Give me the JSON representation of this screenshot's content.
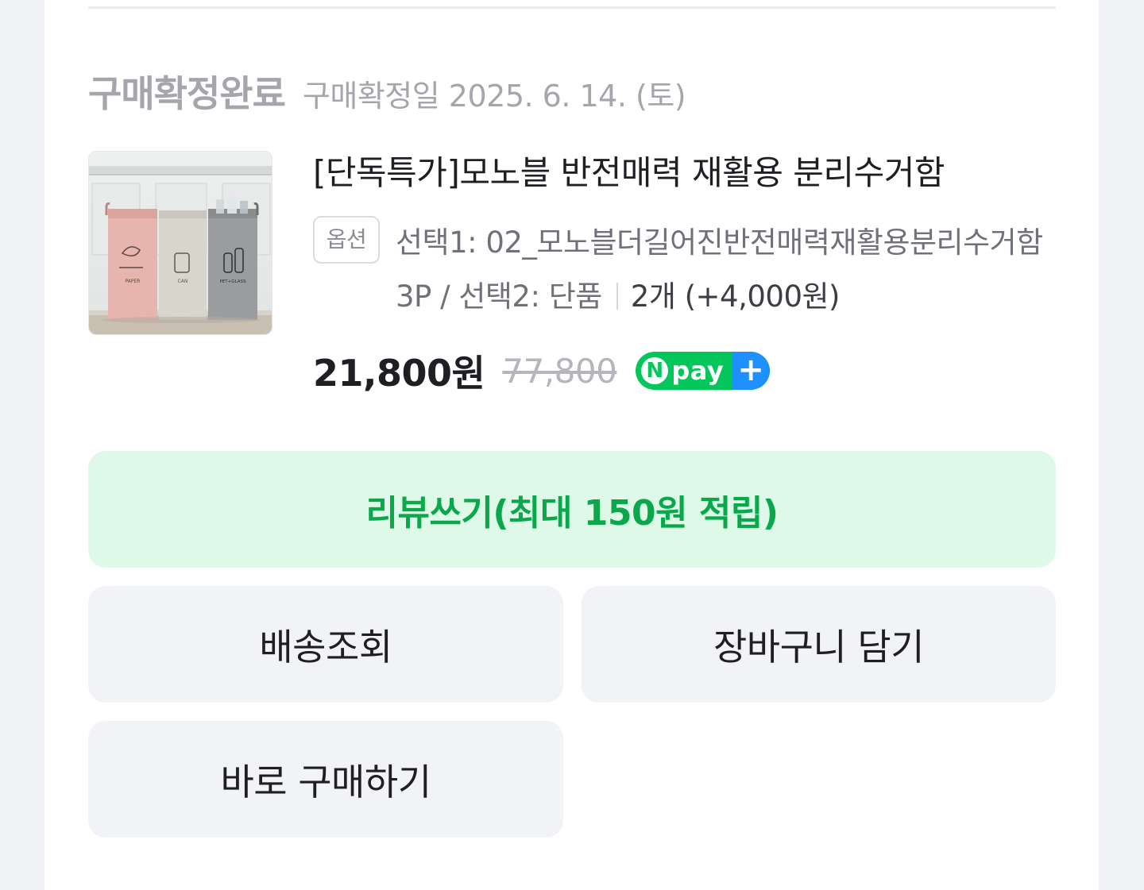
{
  "order": {
    "status": "구매확정완료",
    "confirm_date": "구매확정일 2025. 6. 14. (토)"
  },
  "product": {
    "name": "[단독특가]모노블 반전매력 재활용 분리수거함",
    "option_badge": "옵션",
    "option_text": "선택1: 02_모노블더길어진반전매력재활용분리수거함3P / 선택2: 단품",
    "quantity_text": "2개 (+4,000원)",
    "price": "21,800원",
    "original_price": "77,800",
    "image_labels": [
      "PAPER",
      "CAN",
      "PET+GLASS"
    ]
  },
  "npay": {
    "n": "N",
    "label": "pay",
    "plus": "+",
    "color": "#03c75a",
    "plus_color": "#1e90ff"
  },
  "actions": {
    "review": "리뷰쓰기(최대 150원 적립)",
    "delivery": "배송조회",
    "cart": "장바구니 담기",
    "buy_now": "바로 구매하기"
  },
  "colors": {
    "review_bg": "#dff9e8",
    "review_text": "#0aa84a",
    "button_bg": "#f2f3f6"
  }
}
